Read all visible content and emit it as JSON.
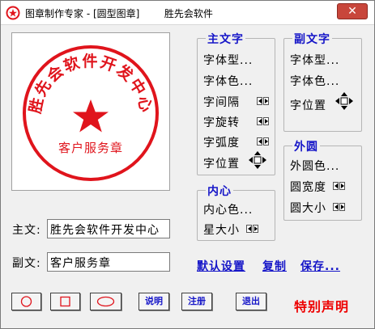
{
  "window": {
    "title": "图章制作专家 - [圆型图章]        胜先会软件",
    "close_symbol": "✕"
  },
  "stamp": {
    "main_text": "胜先会软件开发中心",
    "sub_text": "客户服务章",
    "color": "#e0141c"
  },
  "main_text_group": {
    "title": "主文字",
    "font_type": "字体型...",
    "font_color": "字体色...",
    "char_spacing": "字间隔",
    "char_rotation": "字旋转",
    "char_arc": "字弧度",
    "char_position": "字位置"
  },
  "sub_text_group": {
    "title": "副文字",
    "font_type": "字体型...",
    "font_color": "字体色...",
    "char_position": "字位置"
  },
  "outer_circle_group": {
    "title": "外圆",
    "color": "外圆色...",
    "width": "圆宽度",
    "size": "圆大小"
  },
  "inner_group": {
    "title": "内心",
    "color": "内心色...",
    "star_size": "星大小"
  },
  "fields": {
    "main_label": "主文:",
    "main_value": "胜先会软件开发中心",
    "sub_label": "副文:",
    "sub_value": "客户服务章"
  },
  "links": {
    "default": "默认设置",
    "copy": "复制",
    "save": "保存..."
  },
  "buttons": {
    "help": "说明",
    "register": "注册",
    "exit": "退出"
  },
  "special": "特别声明",
  "colors": {
    "accent": "#1515c8",
    "stamp_red": "#e0141c",
    "close_red": "#c8463b"
  }
}
